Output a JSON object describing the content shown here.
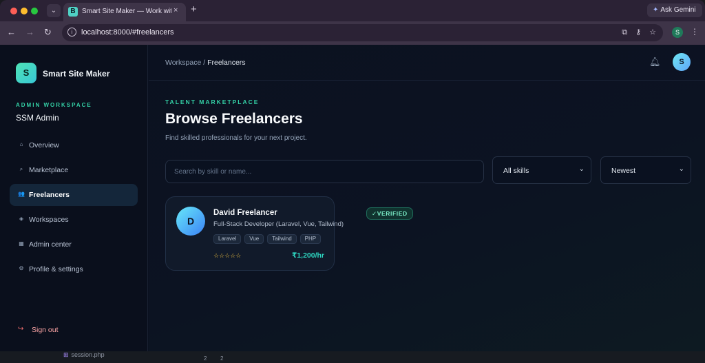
{
  "browser": {
    "tab_favicon": "B",
    "tab_title": "Smart Site Maker — Work with",
    "tab_close": "×",
    "new_tab": "+",
    "ask_gemini": "Ask Gemini",
    "url": "localhost:8000/#freelancers",
    "profile_initial": "S"
  },
  "sidebar": {
    "logo_initial": "S",
    "brand": "Smart Site Maker",
    "workspace_kicker": "ADMIN WORKSPACE",
    "workspace_name": "SSM Admin",
    "items": [
      {
        "label": "Overview",
        "icon": "home-icon",
        "glyph": "⌂"
      },
      {
        "label": "Marketplace",
        "icon": "tag-icon",
        "glyph": "⌕"
      },
      {
        "label": "Freelancers",
        "icon": "users-icon",
        "glyph": "👥",
        "active": true
      },
      {
        "label": "Workspaces",
        "icon": "diamond-icon",
        "glyph": "◈"
      },
      {
        "label": "Admin center",
        "icon": "grid-icon",
        "glyph": "▦"
      },
      {
        "label": "Profile & settings",
        "icon": "gear-icon",
        "glyph": "⚙"
      }
    ],
    "sign_out": "Sign out"
  },
  "header": {
    "breadcrumb_parent": "Workspace",
    "breadcrumb_sep": " / ",
    "breadcrumb_current": "Freelancers",
    "avatar_initial": "S"
  },
  "main": {
    "kicker": "TALENT MARKETPLACE",
    "title": "Browse Freelancers",
    "subtitle": "Find skilled professionals for your next project.",
    "search_placeholder": "Search by skill or name...",
    "skills_filter": "All skills",
    "sort_filter": "Newest"
  },
  "freelancers": [
    {
      "initial": "D",
      "name": "David Freelancer",
      "role": "Full-Stack Developer (Laravel, Vue, Tailwind)",
      "tags": [
        "Laravel",
        "Vue",
        "Tailwind",
        "PHP"
      ],
      "stars": "☆☆☆☆☆",
      "rating": 0,
      "rate": "₹1,200/hr",
      "badge": "✓VERIFIED"
    }
  ],
  "editor_strip": {
    "file": "session.php",
    "numbers": [
      "2",
      "2"
    ]
  },
  "colors": {
    "accent": "#34d1a6",
    "rate": "#2dd4bf",
    "signout": "#f87171",
    "background": "#0b1120"
  }
}
